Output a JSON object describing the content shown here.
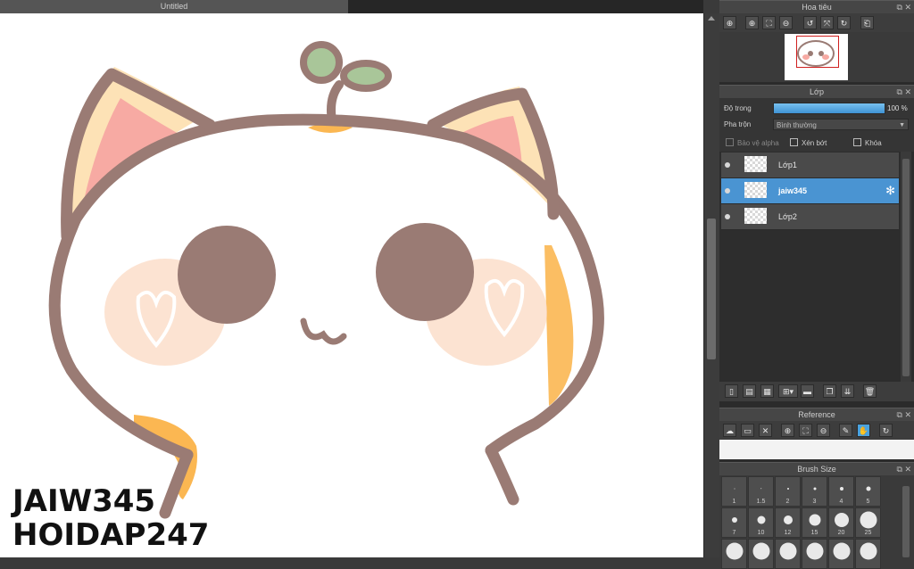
{
  "document": {
    "tab_title": "Untitled"
  },
  "canvas": {
    "watermark_line1": "JAIW345",
    "watermark_line2": "HOIDAP247"
  },
  "navigator": {
    "title": "Hoa tiêu",
    "tools": [
      "zoom-in-icon",
      "zoom-in-icon",
      "fit-icon",
      "zoom-out-icon",
      "rotate-left-icon",
      "flip-icon",
      "rotate-right-icon",
      "reset-icon"
    ]
  },
  "layer_panel": {
    "title": "Lớp",
    "opacity_label": "Độ trong",
    "opacity_value": "100 %",
    "opacity": 1.0,
    "blend_label": "Pha trộn",
    "blend_value": "Bình thường",
    "protect_alpha": "Bảo vệ alpha",
    "clipping": "Xén bớt",
    "lock": "Khóa",
    "layers": [
      {
        "name": "Lớp1",
        "selected": false
      },
      {
        "name": "jaiw345",
        "selected": true
      },
      {
        "name": "Lớp2",
        "selected": false
      }
    ]
  },
  "reference_panel": {
    "title": "Reference"
  },
  "brush_panel": {
    "title": "Brush Size",
    "sizes": [
      "1",
      "1.5",
      "2",
      "3",
      "4",
      "5",
      "7",
      "10",
      "12",
      "15",
      "20",
      "25"
    ]
  },
  "colors": {
    "cat_outline": "#9a7b74",
    "ear_inner": "#f7aaa3",
    "ear_cream": "#fde2b6",
    "blush": "#fbd9c3",
    "orange_spot": "#fbb752",
    "sprout": "#a9c699",
    "selection_blue": "#4a94d2"
  }
}
